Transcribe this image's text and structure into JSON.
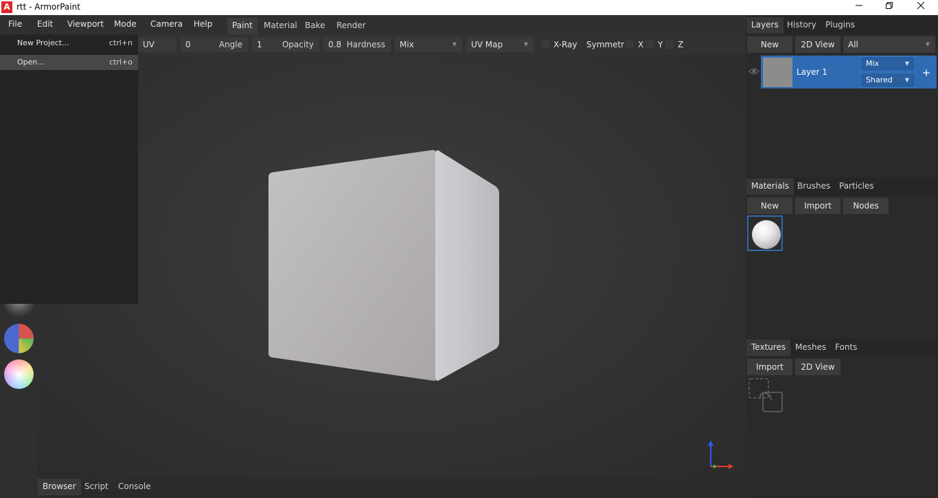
{
  "window": {
    "app_icon": "A",
    "title": "rtt - ArmorPaint",
    "minimize_icon": "minimize-icon",
    "restore_icon": "restore-icon",
    "close_icon": "close-icon"
  },
  "menubar": {
    "items": [
      "File",
      "Edit",
      "Viewport",
      "Mode",
      "Camera",
      "Help"
    ]
  },
  "header_tabs": [
    "Paint",
    "Material",
    "Bake",
    "Render"
  ],
  "active_header_tab": "Paint",
  "toolbar": {
    "uv_scale_label": "UV Scale",
    "angle_value": "0",
    "angle_label": "Angle",
    "opacity_value": "1",
    "opacity_label": "Opacity",
    "hardness_value": "0.8",
    "hardness_label": "Hardness",
    "blend_value": "Mix",
    "uv_map_value": "UV Map",
    "xray_label": "X-Ray",
    "symmetry_label": "Symmetry",
    "x_label": "X",
    "y_label": "Y",
    "z_label": "Z"
  },
  "file_menu": {
    "items": [
      {
        "label": "New Project...",
        "shortcut": "ctrl+n"
      },
      {
        "label": "Open...",
        "shortcut": "ctrl+o"
      }
    ],
    "highlighted": "Open..."
  },
  "bottom_tabs": [
    "Browser",
    "Script",
    "Console"
  ],
  "active_bottom_tab": "Browser",
  "layers_panel": {
    "tabs": [
      "Layers",
      "History",
      "Plugins"
    ],
    "active_tab": "Layers",
    "new_button": "New",
    "view_button": "2D View",
    "filter_value": "All",
    "layer": {
      "name": "Layer 1",
      "blend": "Mix",
      "mode": "Shared",
      "add_symbol": "+"
    }
  },
  "materials_panel": {
    "tabs": [
      "Materials",
      "Brushes",
      "Particles"
    ],
    "active_tab": "Materials",
    "new_button": "New",
    "import_button": "Import",
    "nodes_button": "Nodes"
  },
  "textures_panel": {
    "tabs": [
      "Textures",
      "Meshes",
      "Fonts"
    ],
    "active_tab": "Textures",
    "import_button": "Import",
    "view_button": "2D View"
  },
  "colors": {
    "accent": "#2f6bb3",
    "app_icon": "#e0252b",
    "background": "#2a2a2a"
  }
}
